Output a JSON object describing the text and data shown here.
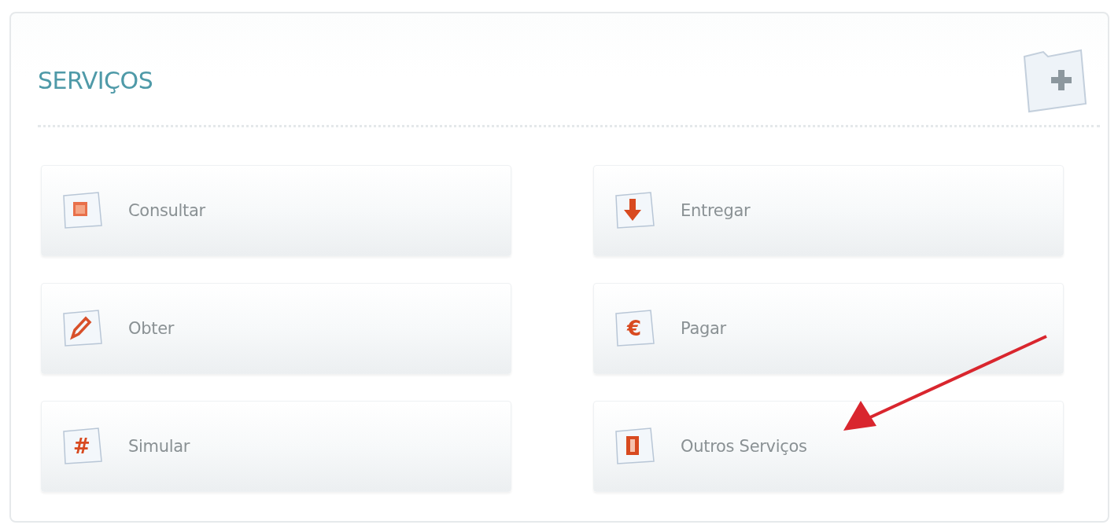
{
  "panel": {
    "title": "SERVIÇOS"
  },
  "services": [
    {
      "label": "Consultar",
      "kind": "calendar"
    },
    {
      "label": "Entregar",
      "kind": "download"
    },
    {
      "label": "Obter",
      "kind": "pencil"
    },
    {
      "label": "Pagar",
      "kind": "glyph",
      "glyph": "€"
    },
    {
      "label": "Simular",
      "kind": "glyph",
      "glyph": "#"
    },
    {
      "label": "Outros Serviços",
      "kind": "tools"
    }
  ]
}
